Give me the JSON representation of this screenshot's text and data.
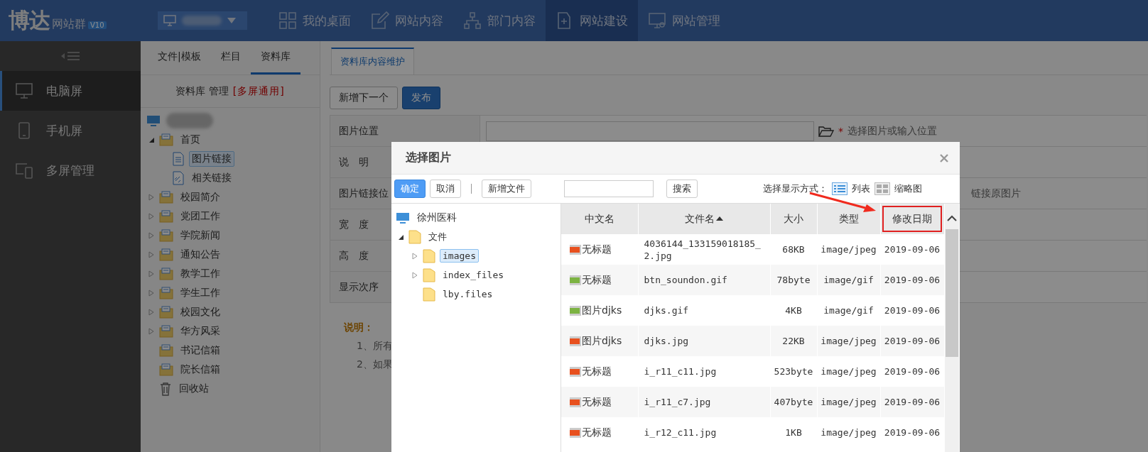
{
  "topbar": {
    "logo": "博达",
    "product": "网站群",
    "version": "V10",
    "nav": [
      {
        "label": "我的桌面",
        "selected": false
      },
      {
        "label": "网站内容",
        "selected": false
      },
      {
        "label": "部门内容",
        "selected": false
      },
      {
        "label": "网站建设",
        "selected": true
      },
      {
        "label": "网站管理",
        "selected": false
      }
    ]
  },
  "sidebar": {
    "items": [
      {
        "label": "电脑屏",
        "selected": true
      },
      {
        "label": "手机屏",
        "selected": false
      },
      {
        "label": "多屏管理",
        "selected": false
      }
    ]
  },
  "panel": {
    "tabs": [
      {
        "label": "文件|模板",
        "selected": false
      },
      {
        "label": "栏目",
        "selected": false
      },
      {
        "label": "资料库",
        "selected": true
      }
    ],
    "title": "资料库 管理",
    "title_tag": "[多屏通用]",
    "tree": [
      {
        "label": "首页",
        "kind": "folder",
        "expanded": true,
        "selected": false,
        "children": [
          {
            "label": "图片链接",
            "kind": "page",
            "selected": true
          },
          {
            "label": "相关链接",
            "kind": "link",
            "selected": false
          }
        ]
      },
      {
        "label": "校园简介",
        "kind": "folder",
        "expanded": false,
        "selected": false
      },
      {
        "label": "党团工作",
        "kind": "folder",
        "expanded": false,
        "selected": false
      },
      {
        "label": "学院新闻",
        "kind": "folder",
        "expanded": false,
        "selected": false
      },
      {
        "label": "通知公告",
        "kind": "folder",
        "expanded": false,
        "selected": false
      },
      {
        "label": "教学工作",
        "kind": "folder",
        "expanded": false,
        "selected": false
      },
      {
        "label": "学生工作",
        "kind": "folder",
        "expanded": false,
        "selected": false
      },
      {
        "label": "校园文化",
        "kind": "folder",
        "expanded": false,
        "selected": false
      },
      {
        "label": "华方风采",
        "kind": "folder",
        "expanded": false,
        "selected": false
      },
      {
        "label": "书记信箱",
        "kind": "folder",
        "selected": false
      },
      {
        "label": "院长信箱",
        "kind": "folder",
        "selected": false
      },
      {
        "label": "回收站",
        "kind": "trash",
        "selected": false
      }
    ]
  },
  "editor": {
    "tabs": [
      {
        "label": "资料库内容维护",
        "selected": true
      }
    ],
    "buttons": [
      {
        "label": "新增下一个",
        "kind": "default"
      },
      {
        "label": "发布",
        "kind": "primary"
      }
    ],
    "form": [
      {
        "label": "图片位置",
        "kind": "location"
      },
      {
        "label": "说　明",
        "kind": "plain"
      },
      {
        "label": "图片链接位",
        "kind": "link"
      },
      {
        "label": "宽　度",
        "kind": "plain"
      },
      {
        "label": "高　度",
        "kind": "plain"
      },
      {
        "label": "显示次序",
        "kind": "plain"
      }
    ],
    "required_mark": "*",
    "location_hint": "选择图片或输入位置",
    "link_original": "链接原图片",
    "notes_title": "说明：",
    "notes": [
      "1、所有",
      "2、如果"
    ]
  },
  "modal": {
    "title": "选择图片",
    "buttons": [
      {
        "label": "确定",
        "kind": "primary"
      },
      {
        "label": "取消",
        "kind": "default"
      },
      {
        "label": "新增文件",
        "kind": "default"
      }
    ],
    "search_button": "搜索",
    "view_label": "选择显示方式：",
    "views": [
      {
        "label": "列表"
      },
      {
        "label": "缩略图"
      }
    ],
    "tree_root": "徐州医科",
    "tree": [
      {
        "label": "文件",
        "expanded": true,
        "selected": false,
        "children": [
          {
            "label": "images",
            "expanded": false,
            "selected": true
          },
          {
            "label": "index_files",
            "expanded": false,
            "selected": false
          },
          {
            "label": "lby.files",
            "selected": false
          }
        ]
      }
    ],
    "table": {
      "columns": [
        {
          "label": "中文名",
          "sorted": false,
          "highlighted": false
        },
        {
          "label": "文件名",
          "sorted": true,
          "highlighted": false
        },
        {
          "label": "大小",
          "sorted": false,
          "highlighted": false
        },
        {
          "label": "类型",
          "sorted": false,
          "highlighted": false
        },
        {
          "label": "修改日期",
          "sorted": false,
          "highlighted": true
        }
      ],
      "rows": [
        {
          "kind": "jpg",
          "name": "无标题",
          "file": "4036144_133159018185_2.jpg",
          "size": "68KB",
          "type": "image/jpeg",
          "date": "2019-09-06"
        },
        {
          "kind": "gif",
          "name": "无标题",
          "file": "btn_soundon.gif",
          "size": "78byte",
          "type": "image/gif",
          "date": "2019-09-06"
        },
        {
          "kind": "gif",
          "name": "图片djks",
          "file": "djks.gif",
          "size": "4KB",
          "type": "image/gif",
          "date": "2019-09-06"
        },
        {
          "kind": "jpg",
          "name": "图片djks",
          "file": "djks.jpg",
          "size": "22KB",
          "type": "image/jpeg",
          "date": "2019-09-06"
        },
        {
          "kind": "jpg",
          "name": "无标题",
          "file": "i_r11_c11.jpg",
          "size": "523byte",
          "type": "image/jpeg",
          "date": "2019-09-06"
        },
        {
          "kind": "jpg",
          "name": "无标题",
          "file": "i_r11_c7.jpg",
          "size": "407byte",
          "type": "image/jpeg",
          "date": "2019-09-06"
        },
        {
          "kind": "jpg",
          "name": "无标题",
          "file": "i_r12_c11.jpg",
          "size": "1KB",
          "type": "image/jpeg",
          "date": "2019-09-06"
        }
      ]
    }
  }
}
